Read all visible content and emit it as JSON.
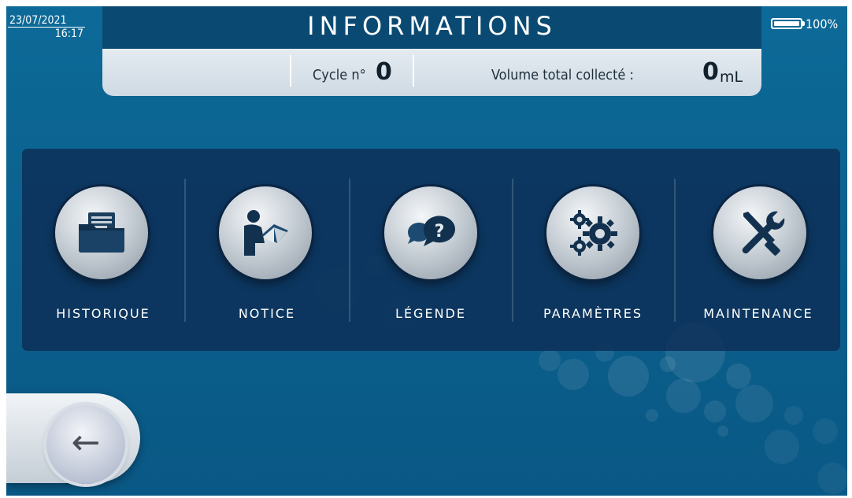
{
  "status": {
    "date": "23/07/2021",
    "time": "16:17",
    "battery_percent": "100%",
    "battery_level": 1.0
  },
  "header": {
    "title": "INFORMATIONS",
    "cycle_label": "Cycle n°",
    "cycle_value": "0",
    "volume_label": "Volume total collecté :",
    "volume_value": "0",
    "volume_unit": "mL"
  },
  "menu": {
    "items": [
      {
        "label": "HISTORIQUE",
        "icon": "folder-icon"
      },
      {
        "label": "NOTICE",
        "icon": "reading-person-icon"
      },
      {
        "label": "LÉGENDE",
        "icon": "speech-bubbles-question-icon"
      },
      {
        "label": "PARAMÈTRES",
        "icon": "gears-icon"
      },
      {
        "label": "MAINTENANCE",
        "icon": "tools-icon"
      }
    ]
  },
  "navigation": {
    "back_icon": "back-arrow-icon",
    "back_glyph": "←"
  },
  "colors": {
    "background": "#0b5f8c",
    "header_band": "#0a4a72",
    "panel": "#0c2d55",
    "text": "#ffffff"
  }
}
